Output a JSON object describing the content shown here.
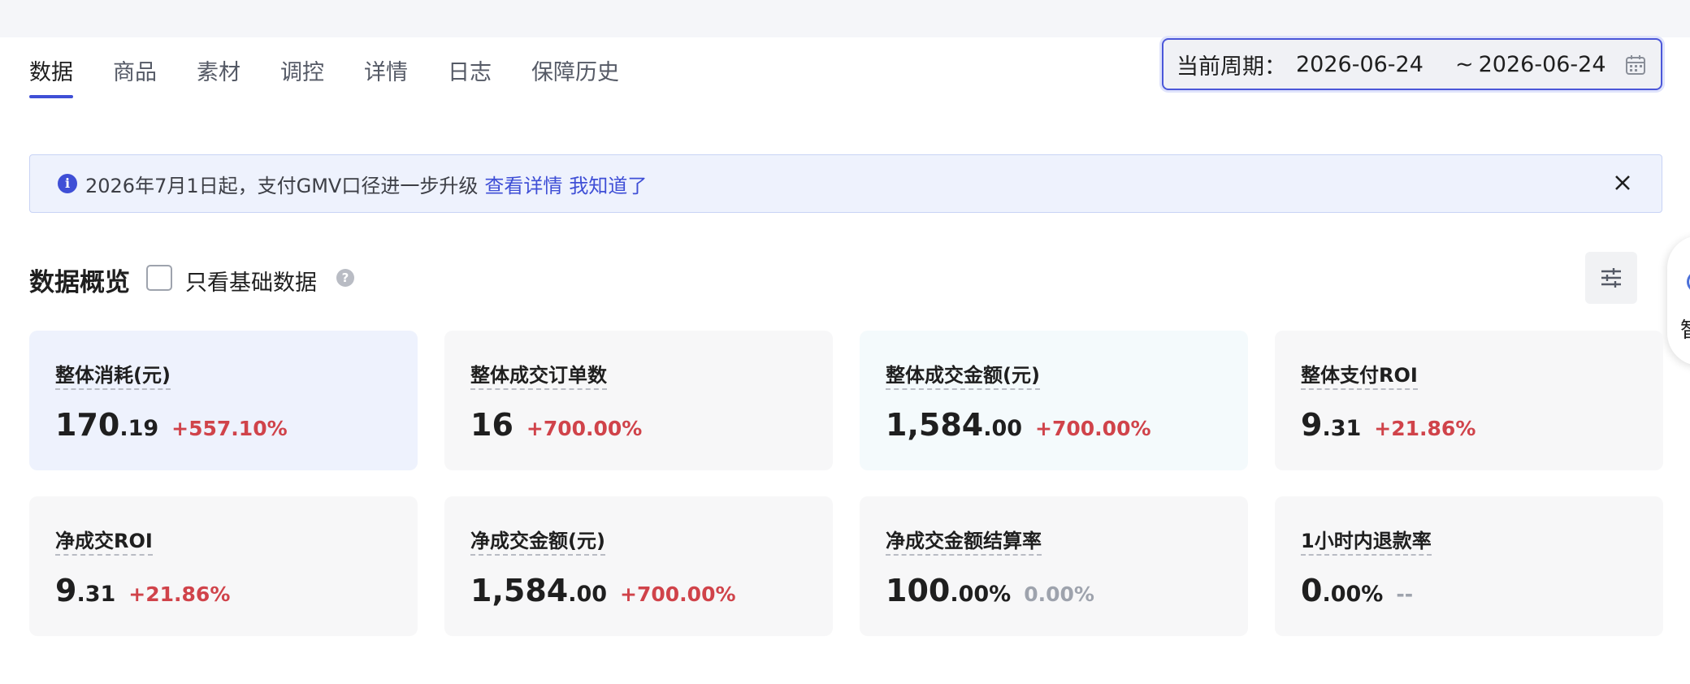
{
  "tabs": [
    {
      "label": "数据",
      "active": true
    },
    {
      "label": "商品",
      "active": false
    },
    {
      "label": "素材",
      "active": false
    },
    {
      "label": "调控",
      "active": false
    },
    {
      "label": "详情",
      "active": false
    },
    {
      "label": "日志",
      "active": false
    },
    {
      "label": "保障历史",
      "active": false
    }
  ],
  "date_range": {
    "label": "当前周期：",
    "start": "2026-06-24",
    "separator": "~",
    "end": "2026-06-24",
    "icon": "calendar-icon"
  },
  "notice": {
    "icon": "info-icon",
    "text": "2026年7月1日起，支付GMV口径进一步升级",
    "link_details": "查看详情",
    "link_ack": "我知道了",
    "close_icon": "close-icon"
  },
  "overview": {
    "title": "数据概览",
    "checkbox_label": "只看基础数据",
    "help_icon": "question-icon",
    "settings_icon": "sliders-icon",
    "side_char": "智"
  },
  "metrics": [
    {
      "name": "整体消耗(元)",
      "int": "170",
      "dec": ".19",
      "change": "+557.10%",
      "trend": "up"
    },
    {
      "name": "整体成交订单数",
      "int": "16",
      "dec": "",
      "change": "+700.00%",
      "trend": "up"
    },
    {
      "name": "整体成交金额(元)",
      "int": "1,584",
      "dec": ".00",
      "change": "+700.00%",
      "trend": "up"
    },
    {
      "name": "整体支付ROI",
      "int": "9",
      "dec": ".31",
      "change": "+21.86%",
      "trend": "up"
    },
    {
      "name": "净成交ROI",
      "int": "9",
      "dec": ".31",
      "change": "+21.86%",
      "trend": "up"
    },
    {
      "name": "净成交金额(元)",
      "int": "1,584",
      "dec": ".00",
      "change": "+700.00%",
      "trend": "up"
    },
    {
      "name": "净成交金额结算率",
      "int": "100",
      "dec": ".00%",
      "change": "0.00%",
      "trend": "flat"
    },
    {
      "name": "1小时内退款率",
      "int": "0",
      "dec": ".00%",
      "change": "--",
      "trend": "flat"
    }
  ],
  "colors": {
    "accent": "#3f4fd6",
    "up": "#d0434a",
    "flat": "#9ea3ad"
  }
}
